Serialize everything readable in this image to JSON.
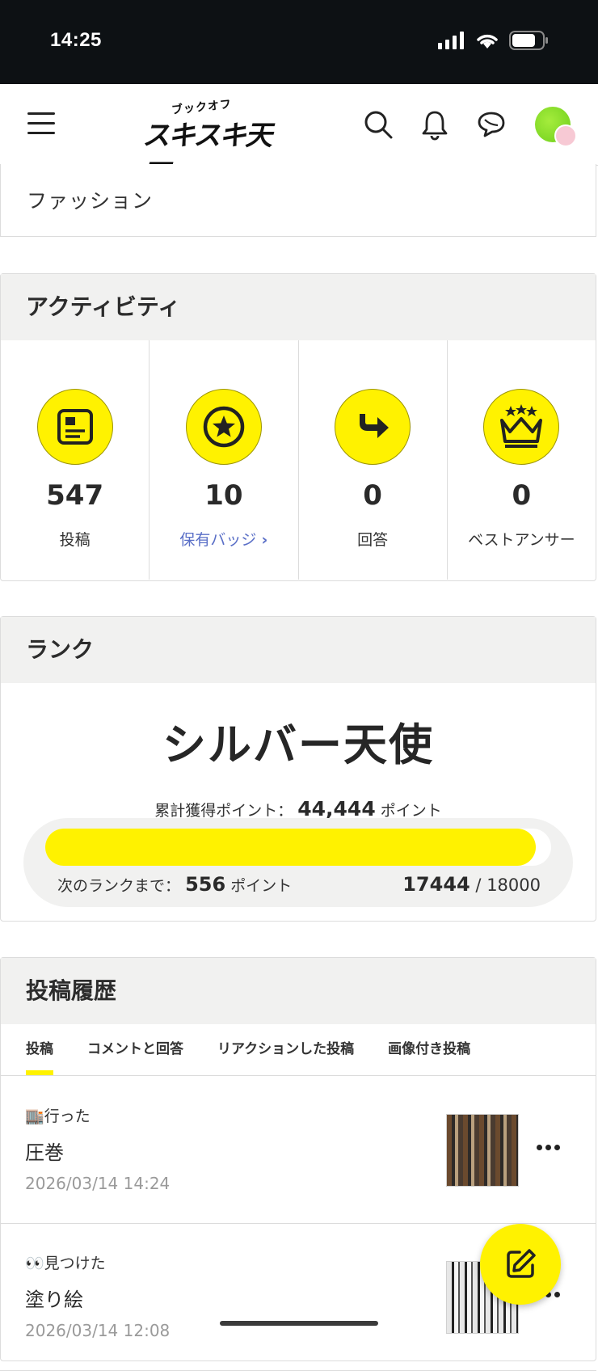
{
  "status_bar": {
    "time": "14:25"
  },
  "header": {
    "logo_small": "ブックオフ",
    "logo_big": "スキスキ天国"
  },
  "category": {
    "label": "ファッション"
  },
  "activity": {
    "heading": "アクティビティ",
    "items": [
      {
        "value": "547",
        "label": "投稿",
        "icon": "document-icon"
      },
      {
        "value": "10",
        "label": "保有バッジ",
        "icon": "star-badge-icon"
      },
      {
        "value": "0",
        "label": "回答",
        "icon": "reply-arrow-icon"
      },
      {
        "value": "0",
        "label": "ベストアンサー",
        "icon": "crown-icon"
      }
    ]
  },
  "rank": {
    "heading": "ランク",
    "title": "シルバー天使",
    "total_label": "累計獲得ポイント：",
    "total_value": "44,444",
    "total_unit": "ポイント",
    "next_label": "次のランクまで：",
    "next_value": "556",
    "next_unit": "ポイント",
    "current": "17444",
    "separator": "/",
    "max": "18000",
    "progress_fraction": 0.969
  },
  "history": {
    "heading": "投稿履歴",
    "tabs": [
      "投稿",
      "コメントと回答",
      "リアクションした投稿",
      "画像付き投稿"
    ],
    "posts": [
      {
        "category": "🏬行った",
        "title": "圧巻",
        "date": "2026/03/14 14:24"
      },
      {
        "category": "👀見つけた",
        "title": "塗り絵",
        "date": "2026/03/14 12:08"
      }
    ]
  },
  "colors": {
    "accent": "#fff200",
    "link": "#5a6fc7",
    "section_bg": "#f1f1f0"
  }
}
